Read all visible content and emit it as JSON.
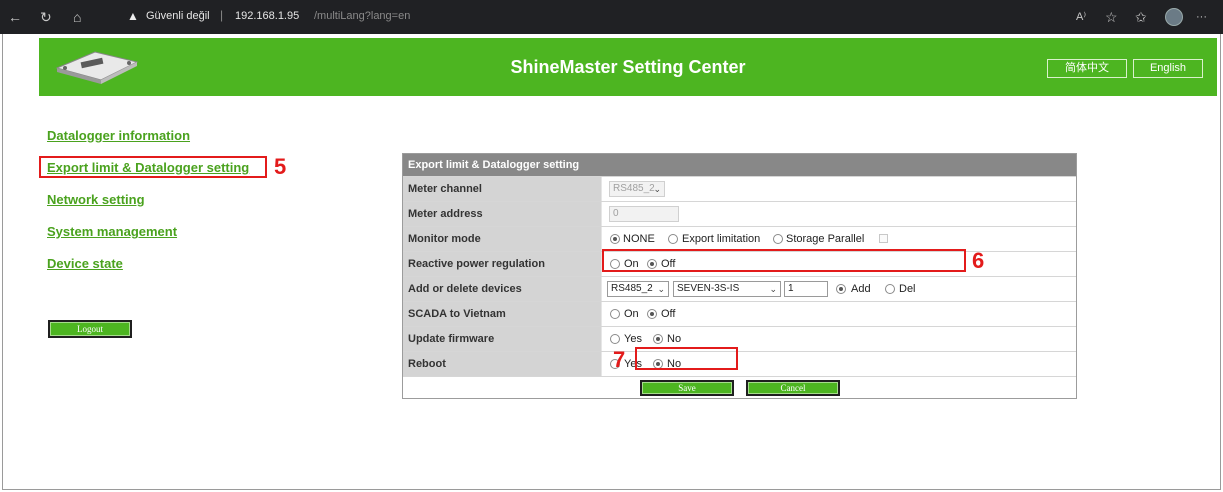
{
  "browser": {
    "security_label": "Güvenli değil",
    "separator": "|",
    "url_host": "192.168.1.95",
    "url_path": "/multiLang?lang=en",
    "back_glyph": "←",
    "refresh_glyph": "↻",
    "home_glyph": "⌂",
    "warn_glyph": "▲",
    "read_aloud_glyph": "A⁾",
    "favorite_glyph": "☆",
    "favorites_glyph": "✩",
    "collections_glyph": "⊞",
    "more_glyph": "···"
  },
  "header": {
    "title": "ShineMaster Setting Center",
    "lang_chinese": "简体中文",
    "lang_english": "English",
    "accent_color": "#4db521"
  },
  "sidebar": {
    "items": [
      {
        "label": "Datalogger information"
      },
      {
        "label": "Export limit & Datalogger setting"
      },
      {
        "label": "Network setting"
      },
      {
        "label": "System management"
      },
      {
        "label": "Device state"
      }
    ],
    "logout_label": "Logout"
  },
  "panel": {
    "title": "Export limit & Datalogger setting",
    "meter_channel": {
      "label": "Meter channel",
      "value": "RS485_2"
    },
    "meter_address": {
      "label": "Meter address",
      "value": "0"
    },
    "monitor_mode": {
      "label": "Monitor mode",
      "options": [
        "NONE",
        "Export limitation",
        "Storage Parallel"
      ],
      "selected": "NONE"
    },
    "reactive_power": {
      "label": "Reactive power regulation",
      "options": [
        "On",
        "Off"
      ],
      "selected": "Off"
    },
    "add_delete": {
      "label": "Add or delete devices",
      "port": "RS485_2",
      "device": "SEVEN-3S-IS",
      "address": "1",
      "options": [
        "Add",
        "Del"
      ],
      "selected": "Add"
    },
    "scada": {
      "label": "SCADA to Vietnam",
      "options": [
        "On",
        "Off"
      ],
      "selected": "Off"
    },
    "update_firmware": {
      "label": "Update firmware",
      "options": [
        "Yes",
        "No"
      ],
      "selected": "No"
    },
    "reboot": {
      "label": "Reboot",
      "options": [
        "Yes",
        "No"
      ],
      "selected": "No"
    },
    "save_label": "Save",
    "cancel_label": "Cancel"
  },
  "annotations": {
    "five": "5",
    "six": "6",
    "seven": "7",
    "color": "#e31b1b"
  }
}
